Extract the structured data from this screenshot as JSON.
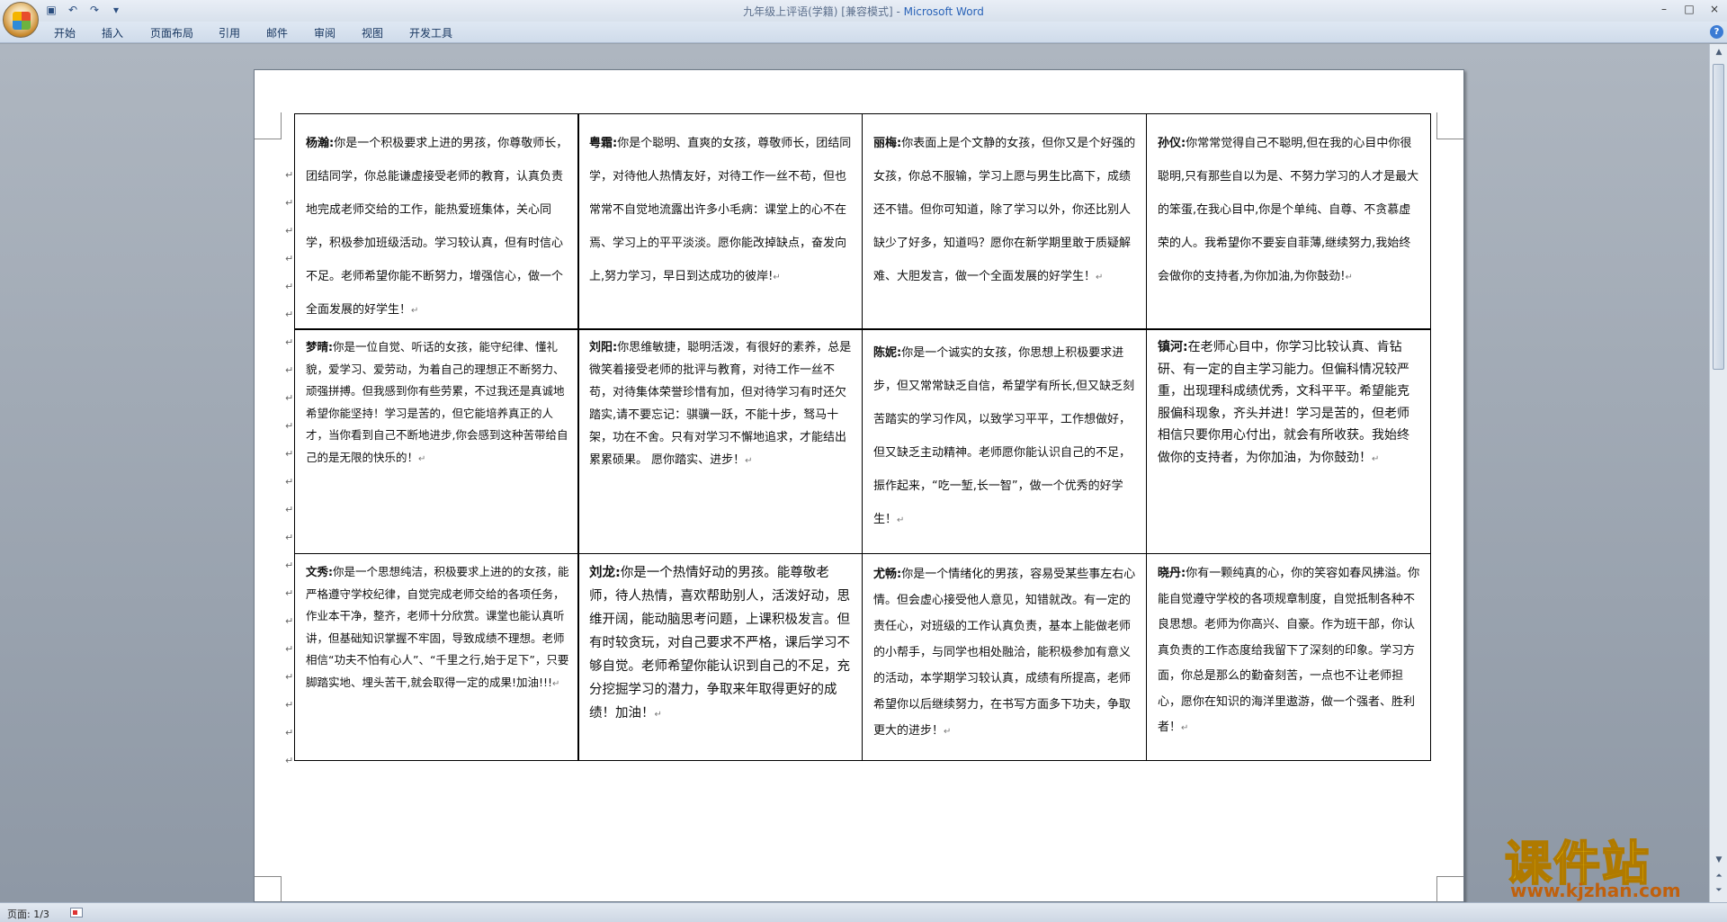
{
  "window": {
    "title": "九年级上评语(学籍) [兼容模式]",
    "separator": " - ",
    "app_name": "Microsoft Word",
    "controls": [
      "–",
      "□",
      "×"
    ]
  },
  "qat": {
    "save": "▣",
    "undo": "↶",
    "redo": "↷",
    "more": "▾"
  },
  "ribbon": {
    "tabs": [
      "开始",
      "插入",
      "页面布局",
      "引用",
      "邮件",
      "审阅",
      "视图",
      "开发工具"
    ]
  },
  "status": {
    "page": "页面: 1/3"
  },
  "watermark": {
    "big": "课件站",
    "small": "www.kjzhan.com"
  },
  "comments": [
    {
      "name": "杨瀚:",
      "text": "你是一个积极要求上进的男孩，你尊敬师长，团结同学，你总能谦虚接受老师的教育，认真负责地完成老师交给的工作，能热爱班集体，关心同学，积极参加班级活动。学习较认真，但有时信心不足。老师希望你能不断努力，增强信心，做一个全面发展的好学生！"
    },
    {
      "name": "粤霜:",
      "text": "你是个聪明、直爽的女孩，尊敬师长，团结同学，对待他人热情友好，对待工作一丝不苟，但也常常不自觉地流露出许多小毛病：课堂上的心不在焉、学习上的平平淡淡。愿你能改掉缺点，奋发向上,努力学习，早日到达成功的彼岸!"
    },
    {
      "name": "丽梅:",
      "text": "你表面上是个文静的女孩，但你又是个好强的女孩，你总不服输，学习上愿与男生比高下，成绩还不错。但你可知道，除了学习以外，你还比别人缺少了好多，知道吗？愿你在新学期里敢于质疑解难、大胆发言，做一个全面发展的好学生！"
    },
    {
      "name": "孙仪:",
      "text": "你常常觉得自己不聪明,但在我的心目中你很聪明,只有那些自以为是、不努力学习的人才是最大的笨蛋,在我心目中,你是个单纯、自尊、不贪慕虚荣的人。我希望你不要妄自菲薄,继续努力,我始终会做你的支持者,为你加油,为你鼓劲!"
    },
    {
      "name": "梦晴:",
      "text": "你是一位自觉、听话的女孩，能守纪律、懂礼貌，爱学习、爱劳动，为着自己的理想正不断努力、顽强拼搏。但我感到你有些劳累，不过我还是真诚地希望你能坚持！学习是苦的，但它能培养真正的人才，当你看到自己不断地进步,你会感到这种苦带给自己的是无限的快乐的！"
    },
    {
      "name": "刘阳:",
      "text": "你思维敏捷，聪明活泼，有很好的素养，总是微笑着接受老师的批评与教育，对待工作一丝不苟，对待集体荣誉珍惜有加，但对待学习有时还欠踏实,请不要忘记：骐骥一跃，不能十步，驽马十架，功在不舍。只有对学习不懈地追求，才能结出累累硕果。  愿你踏实、进步！"
    },
    {
      "name": "陈妮:",
      "text": "你是一个诚实的女孩，你思想上积极要求进步，但又常常缺乏自信，希望学有所长,但又缺乏刻苦踏实的学习作风，以致学习平平，工作想做好，但又缺乏主动精神。老师愿你能认识自己的不足，振作起来，“吃一堑,长一智”，做一个优秀的好学生！"
    },
    {
      "name": "镇河:",
      "text": "在老师心目中，你学习比较认真、肯钻研、有一定的自主学习能力。但偏科情况较严重，出现理科成绩优秀，文科平平。希望能克服偏科现象，齐头并进！学习是苦的，但老师相信只要你用心付出，就会有所收获。我始终做你的支持者，为你加油，为你鼓劲！"
    },
    {
      "name": "文秀:",
      "text": "你是一个思想纯洁，积极要求上进的的女孩，能严格遵守学校纪律，自觉完成老师交给的各项任务，作业本干净，整齐，老师十分欣赏。课堂也能认真听讲，但基础知识掌握不牢固，导致成绩不理想。老师相信“功夫不怕有心人”、“千里之行,始于足下”，只要脚踏实地、埋头苦干,就会取得一定的成果!加油!!!"
    },
    {
      "name": "刘龙:",
      "text": "你是一个热情好动的男孩。能尊敬老师，待人热情，喜欢帮助别人，活泼好动，思维开阔，能动脑思考问题，上课积极发言。但有时较贪玩，对自己要求不严格，课后学习不够自觉。老师希望你能认识到自己的不足，充分挖掘学习的潜力，争取来年取得更好的成绩！加油！"
    },
    {
      "name": "尤畅:",
      "text": "你是一个情绪化的男孩，容易受某些事左右心情。但会虚心接受他人意见，知错就改。有一定的责任心，对班级的工作认真负责，基本上能做老师的小帮手，与同学也相处融洽，能积极参加有意义的活动，本学期学习较认真，成绩有所提高，老师希望你以后继续努力，在书写方面多下功夫，争取更大的进步！"
    },
    {
      "name": "晓丹:",
      "text": "你有一颗纯真的心，你的笑容如春风拂溢。你能自觉遵守学校的各项规章制度，自觉抵制各种不良思想。老师为你高兴、自豪。作为班干部，你认真负责的工作态度给我留下了深刻的印象。学习方面，你总是那么的勤奋刻苦，一点也不让老师担心，愿你在知识的海洋里遨游，做一个强者、胜利者！"
    }
  ],
  "marks": {
    "para": "↵"
  }
}
